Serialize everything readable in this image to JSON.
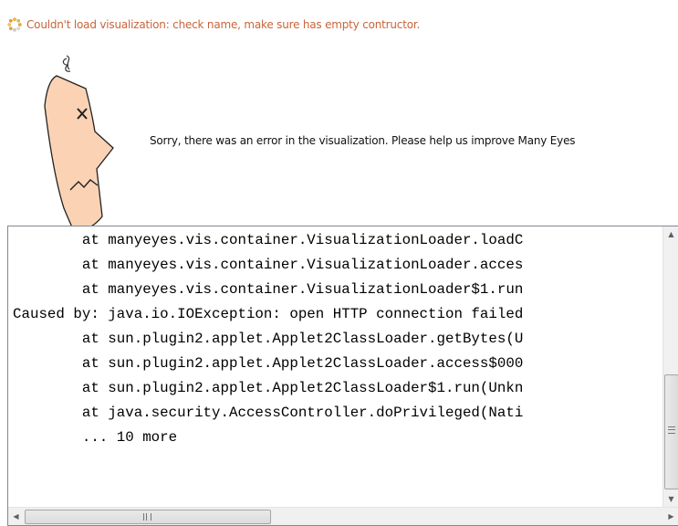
{
  "status": {
    "icon": "loading-spinner-icon",
    "message": "Couldn't load visualization: check name, make sure has empty contructor."
  },
  "error_panel": {
    "illustration": "confused-face-icon",
    "sorry_text": "Sorry, there was an error in the visualization. Please help us improve Many Eyes"
  },
  "trace": {
    "lines": [
      "        at manyeyes.vis.container.VisualizationLoader.loadC",
      "        at manyeyes.vis.container.VisualizationLoader.acces",
      "        at manyeyes.vis.container.VisualizationLoader$1.run",
      "Caused by: java.io.IOException: open HTTP connection failed",
      "        at sun.plugin2.applet.Applet2ClassLoader.getBytes(U",
      "        at sun.plugin2.applet.Applet2ClassLoader.access$000",
      "        at sun.plugin2.applet.Applet2ClassLoader$1.run(Unkn",
      "        at java.security.AccessController.doPrivileged(Nati",
      "        ... 10 more"
    ]
  },
  "scrollbars": {
    "up": "▲",
    "down": "▼",
    "left": "◀",
    "right": "▶"
  },
  "colors": {
    "status_text": "#c8643a",
    "face_fill": "#fbd3b4"
  }
}
